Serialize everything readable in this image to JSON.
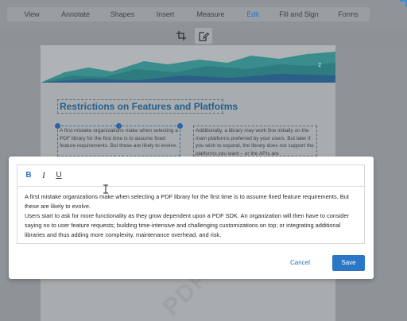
{
  "toolbar": {
    "tabs": [
      {
        "label": "View"
      },
      {
        "label": "Annotate"
      },
      {
        "label": "Shapes"
      },
      {
        "label": "Insert"
      },
      {
        "label": "Measure"
      },
      {
        "label": "Edit",
        "active": true
      },
      {
        "label": "Fill and Sign"
      },
      {
        "label": "Forms"
      }
    ],
    "tools": [
      "crop-icon",
      "edit-content-icon"
    ]
  },
  "document": {
    "page_number": "2",
    "heading": "Restrictions on Features and Platforms",
    "left_column": "A first mistake organizations make when selecting a PDF library for the first time is to assume fixed feature requirements. But these are likely to evolve.",
    "right_column": "Additionally, a library may work fine initially on the main platforms preferred by your users. But later if you wish to expand, the library does not support the platforms you want – or the APIs are",
    "watermark": "PDF"
  },
  "editor": {
    "bold_label": "B",
    "italic_label": "I",
    "underline_label": "U",
    "paragraph1": "A first mistake organizations make when selecting a PDF library for the first time is to assume fixed feature requirements. But these are likely to evolve.",
    "paragraph2": "Users start to ask for more functionality as they grow dependent upon a PDF SDK. An organization will then have to consider saying no to user feature requests; building time-intensive and challenging customizations on top; or integrating additional libraries and thus adding more complexity, maintenance overhead, and risk."
  },
  "dialog": {
    "cancel_label": "Cancel",
    "save_label": "Save"
  },
  "colors": {
    "accent": "#2a78c5",
    "heading": "#24608f"
  }
}
